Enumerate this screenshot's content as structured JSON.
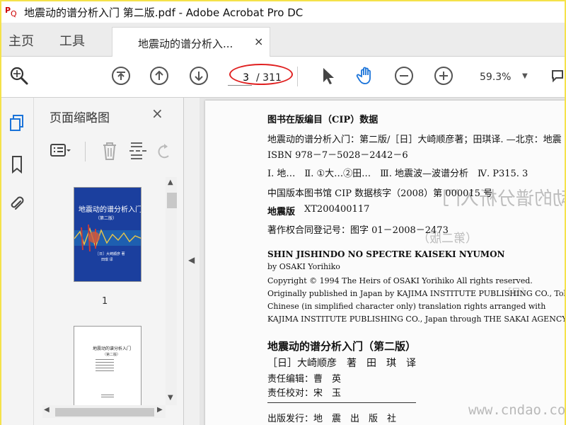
{
  "window": {
    "title": "地震动的谱分析入门 第二版.pdf - Adobe Acrobat Pro DC"
  },
  "tabs": {
    "home": "主页",
    "tools": "工具",
    "document": "地震动的谱分析入...",
    "close": "×"
  },
  "toolbar": {
    "page_current": "3",
    "page_total": "/ 311",
    "zoom": "59.3%"
  },
  "panel": {
    "title": "页面缩略图",
    "close": "×",
    "thumbnails": [
      {
        "page_label": "1",
        "cover_title": "地震动的谱分析入门",
        "cover_edition": "（第二版）",
        "cover_author": "［日］大崎顺彦 著",
        "cover_translator": "田琪 译"
      },
      {
        "page_label": "",
        "title": "地震动的谱分析入门",
        "edition": "（第二版）"
      }
    ]
  },
  "document": {
    "cip_heading": "图书在版编目（CIP）数据",
    "line1": "地震动的谱分析入门：第二版/［日］大崎顺彦著；田琪译. —北京：地震",
    "line2": "ISBN 978－7－5028－2442－6",
    "line3": "Ⅰ. 地…　Ⅱ. ①大…②田…　Ⅲ. 地震波—波谱分析　Ⅳ. P315. 3",
    "line4": "中国版本图书馆 CIP 数据核字（2008）第 000015 号",
    "line5_label": "地震版",
    "line5_value": "XT200400117",
    "line6": "著作权合同登记号：图字 01－2008－2473",
    "en1": "SHIN JISHINDO NO SPECTRE KAISEKI NYUMON",
    "en2": "by OSAKI Yorihiko",
    "en3": "Copyright © 1994 The Heirs of OSAKI Yorihiko All rights reserved.",
    "en4": "Originally published in Japan by KAJIMA INSTITUTE PUBLISHING CO., Tokyo.",
    "en5": "Chinese (in simplified character only) translation rights arranged with",
    "en6": "KAJIMA INSTITUTE PUBLISHING CO., Japan through THE SAKAI AGENCY.",
    "book_title": "地震动的谱分析入门（第二版）",
    "authors": "［日］大崎顺彦　著　田　琪　译",
    "editor": "责任编辑：曹　英",
    "proof": "责任校对：宋　玉",
    "publisher": "出版发行：地　震　出　版　社",
    "ghost_title": "地震动的谱分析入门",
    "ghost_edition": "（第二版）",
    "ghost_author_small": "［日］"
  },
  "watermark": "www.cndao.com"
}
